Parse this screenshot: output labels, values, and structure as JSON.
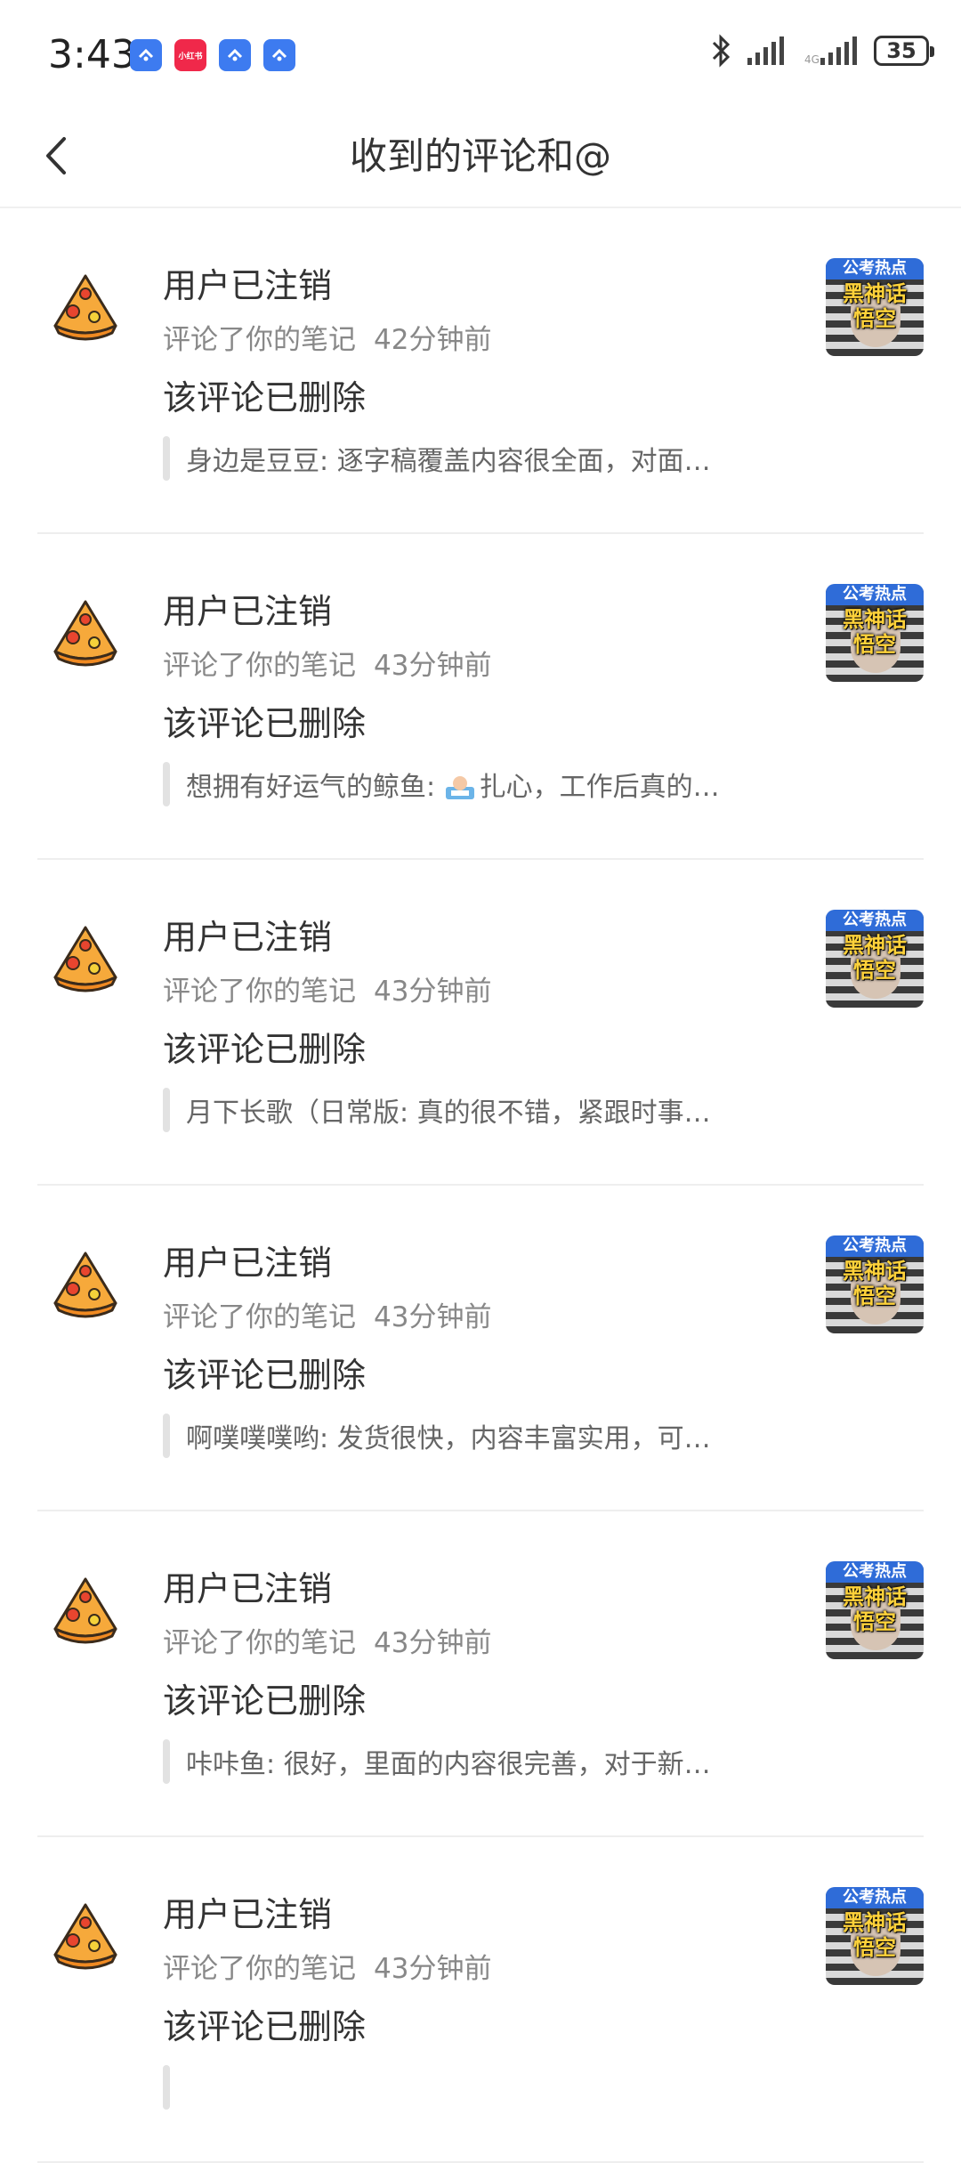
{
  "status_bar": {
    "time": "3:43",
    "notification_icons": [
      "blue-app-icon",
      "xiaohongshu-icon",
      "blue-app-icon",
      "blue-app-icon"
    ],
    "xiaohongshu_label": "小红书",
    "bluetooth_icon": "bluetooth-icon",
    "battery": "35"
  },
  "header": {
    "title": "收到的评论和@",
    "back_icon": "chevron-left-icon"
  },
  "thumbnail": {
    "tag": "公考热点",
    "text": "黑神话悟空"
  },
  "items": [
    {
      "user": "用户已注销",
      "action": "评论了你的笔记",
      "time": "42分钟前",
      "comment": "该评论已删除",
      "quote": "身边是豆豆: 逐字稿覆盖内容很全面，对面…"
    },
    {
      "user": "用户已注销",
      "action": "评论了你的笔记",
      "time": "43分钟前",
      "comment": "该评论已删除",
      "quote_prefix": "想拥有好运气的鲸鱼: ",
      "quote_emoji": "office-worker-emoji",
      "quote": "扎心，工作后真的…"
    },
    {
      "user": "用户已注销",
      "action": "评论了你的笔记",
      "time": "43分钟前",
      "comment": "该评论已删除",
      "quote": "月下长歌（日常版: 真的很不错，紧跟时事…"
    },
    {
      "user": "用户已注销",
      "action": "评论了你的笔记",
      "time": "43分钟前",
      "comment": "该评论已删除",
      "quote": "啊噗噗噗哟: 发货很快，内容丰富实用，可…"
    },
    {
      "user": "用户已注销",
      "action": "评论了你的笔记",
      "time": "43分钟前",
      "comment": "该评论已删除",
      "quote": "咔咔鱼: 很好，里面的内容很完善，对于新…"
    },
    {
      "user": "用户已注销",
      "action": "评论了你的笔记",
      "time": "43分钟前",
      "comment": "该评论已删除",
      "quote": ""
    }
  ],
  "colors": {
    "accent_blue": "#3d7bf0",
    "xiaohongshu_red": "#f0284a",
    "text_primary": "#333333",
    "text_secondary": "#888888"
  }
}
